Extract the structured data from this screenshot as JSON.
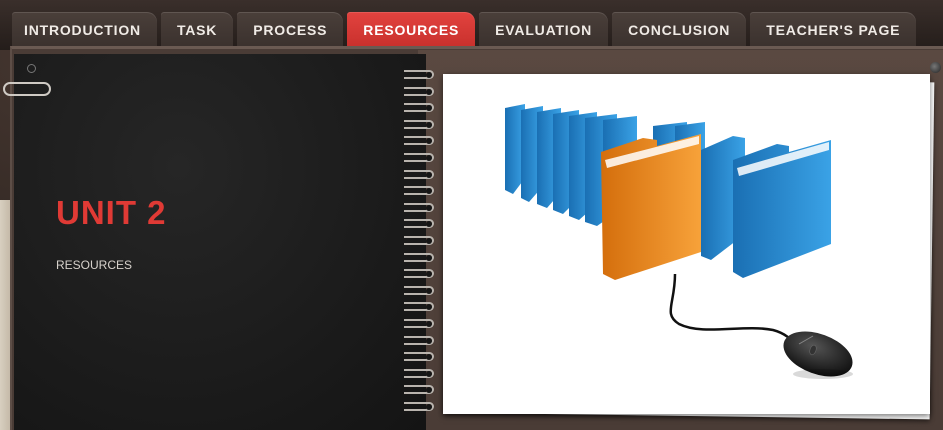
{
  "tabs": [
    {
      "label": "INTRODUCTION",
      "active": false
    },
    {
      "label": "TASK",
      "active": false
    },
    {
      "label": "PROCESS",
      "active": false
    },
    {
      "label": "RESOURCES",
      "active": true
    },
    {
      "label": "EVALUATION",
      "active": false
    },
    {
      "label": "CONCLUSION",
      "active": false
    },
    {
      "label": "TEACHER'S PAGE",
      "active": false
    }
  ],
  "content": {
    "title": "UNIT 2",
    "subtitle": "RESOURCES"
  },
  "image": {
    "icon": "folders-mouse-photo"
  },
  "colors": {
    "accent": "#e03a35",
    "chalkboard": "#1b1b1b",
    "frame": "#4a3c36",
    "folder_blue": "#2f8fd0",
    "folder_orange": "#f08a1c"
  }
}
